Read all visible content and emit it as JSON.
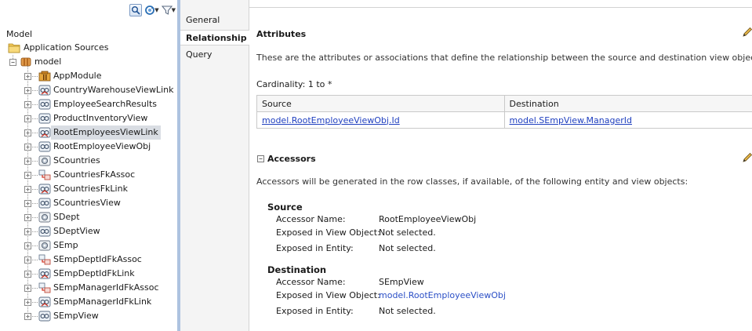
{
  "navigator": {
    "title": "Model",
    "tree": [
      {
        "label": "Application Sources",
        "icon": "folder-icon",
        "level": 0,
        "expander": ""
      },
      {
        "label": "model",
        "icon": "package-icon",
        "level": 1,
        "expander": "−"
      },
      {
        "label": "AppModule",
        "icon": "app-module-icon",
        "level": 2,
        "expander": "+"
      },
      {
        "label": "CountryWarehouseViewLink",
        "icon": "view-link-icon",
        "level": 2,
        "expander": "+"
      },
      {
        "label": "EmployeeSearchResults",
        "icon": "view-object-icon",
        "level": 2,
        "expander": "+"
      },
      {
        "label": "ProductInventoryView",
        "icon": "view-object-icon",
        "level": 2,
        "expander": "+"
      },
      {
        "label": "RootEmployeesViewLink",
        "icon": "view-link-icon",
        "level": 2,
        "expander": "+",
        "selected": true
      },
      {
        "label": "RootEmployeeViewObj",
        "icon": "view-object-icon",
        "level": 2,
        "expander": "+"
      },
      {
        "label": "SCountries",
        "icon": "entity-object-icon",
        "level": 2,
        "expander": "+"
      },
      {
        "label": "SCountriesFkAssoc",
        "icon": "association-icon",
        "level": 2,
        "expander": "+"
      },
      {
        "label": "SCountriesFkLink",
        "icon": "view-link-icon",
        "level": 2,
        "expander": "+"
      },
      {
        "label": "SCountriesView",
        "icon": "view-object-icon",
        "level": 2,
        "expander": "+"
      },
      {
        "label": "SDept",
        "icon": "entity-object-icon",
        "level": 2,
        "expander": "+"
      },
      {
        "label": "SDeptView",
        "icon": "view-object-icon",
        "level": 2,
        "expander": "+"
      },
      {
        "label": "SEmp",
        "icon": "entity-object-icon",
        "level": 2,
        "expander": "+"
      },
      {
        "label": "SEmpDeptIdFkAssoc",
        "icon": "association-icon",
        "level": 2,
        "expander": "+"
      },
      {
        "label": "SEmpDeptIdFkLink",
        "icon": "view-link-icon",
        "level": 2,
        "expander": "+"
      },
      {
        "label": "SEmpManagerIdFkAssoc",
        "icon": "association-icon",
        "level": 2,
        "expander": "+"
      },
      {
        "label": "SEmpManagerIdFkLink",
        "icon": "view-link-icon",
        "level": 2,
        "expander": "+"
      },
      {
        "label": "SEmpView",
        "icon": "view-object-icon",
        "level": 2,
        "expander": "+"
      }
    ]
  },
  "tabs": [
    {
      "label": "General",
      "active": false
    },
    {
      "label": "Relationship",
      "active": true
    },
    {
      "label": "Query",
      "active": false
    }
  ],
  "attributes": {
    "title": "Attributes",
    "description": "These are the attributes or associations that define the relationship between the source and destination view objects.",
    "cardinality_label": "Cardinality: 1 to *",
    "table": {
      "headers": [
        "Source",
        "Destination"
      ],
      "rows": [
        [
          "model.RootEmployeeViewObj.Id",
          "model.SEmpView.ManagerId"
        ]
      ]
    }
  },
  "accessors": {
    "collapse_glyph": "−",
    "title": "Accessors",
    "description": "Accessors will be generated in the row classes, if available, of the following entity and view objects:",
    "source": {
      "title": "Source",
      "accessor_name_key": "Accessor Name:",
      "accessor_name_val": "RootEmployeeViewObj",
      "exposed_vo_key": "Exposed in View Object:",
      "exposed_vo_val": "Not selected.",
      "exposed_entity_key": "Exposed in Entity:",
      "exposed_entity_val": "Not selected."
    },
    "destination": {
      "title": "Destination",
      "accessor_name_key": "Accessor Name:",
      "accessor_name_val": "SEmpView",
      "exposed_vo_key": "Exposed in View Object:",
      "exposed_vo_val": "model.RootEmployeeViewObj",
      "exposed_entity_key": "Exposed in Entity:",
      "exposed_entity_val": "Not selected."
    }
  },
  "colors": {
    "link": "#1f3fbf",
    "splitter": "#adc3e0",
    "selection": "#d9dde3"
  }
}
